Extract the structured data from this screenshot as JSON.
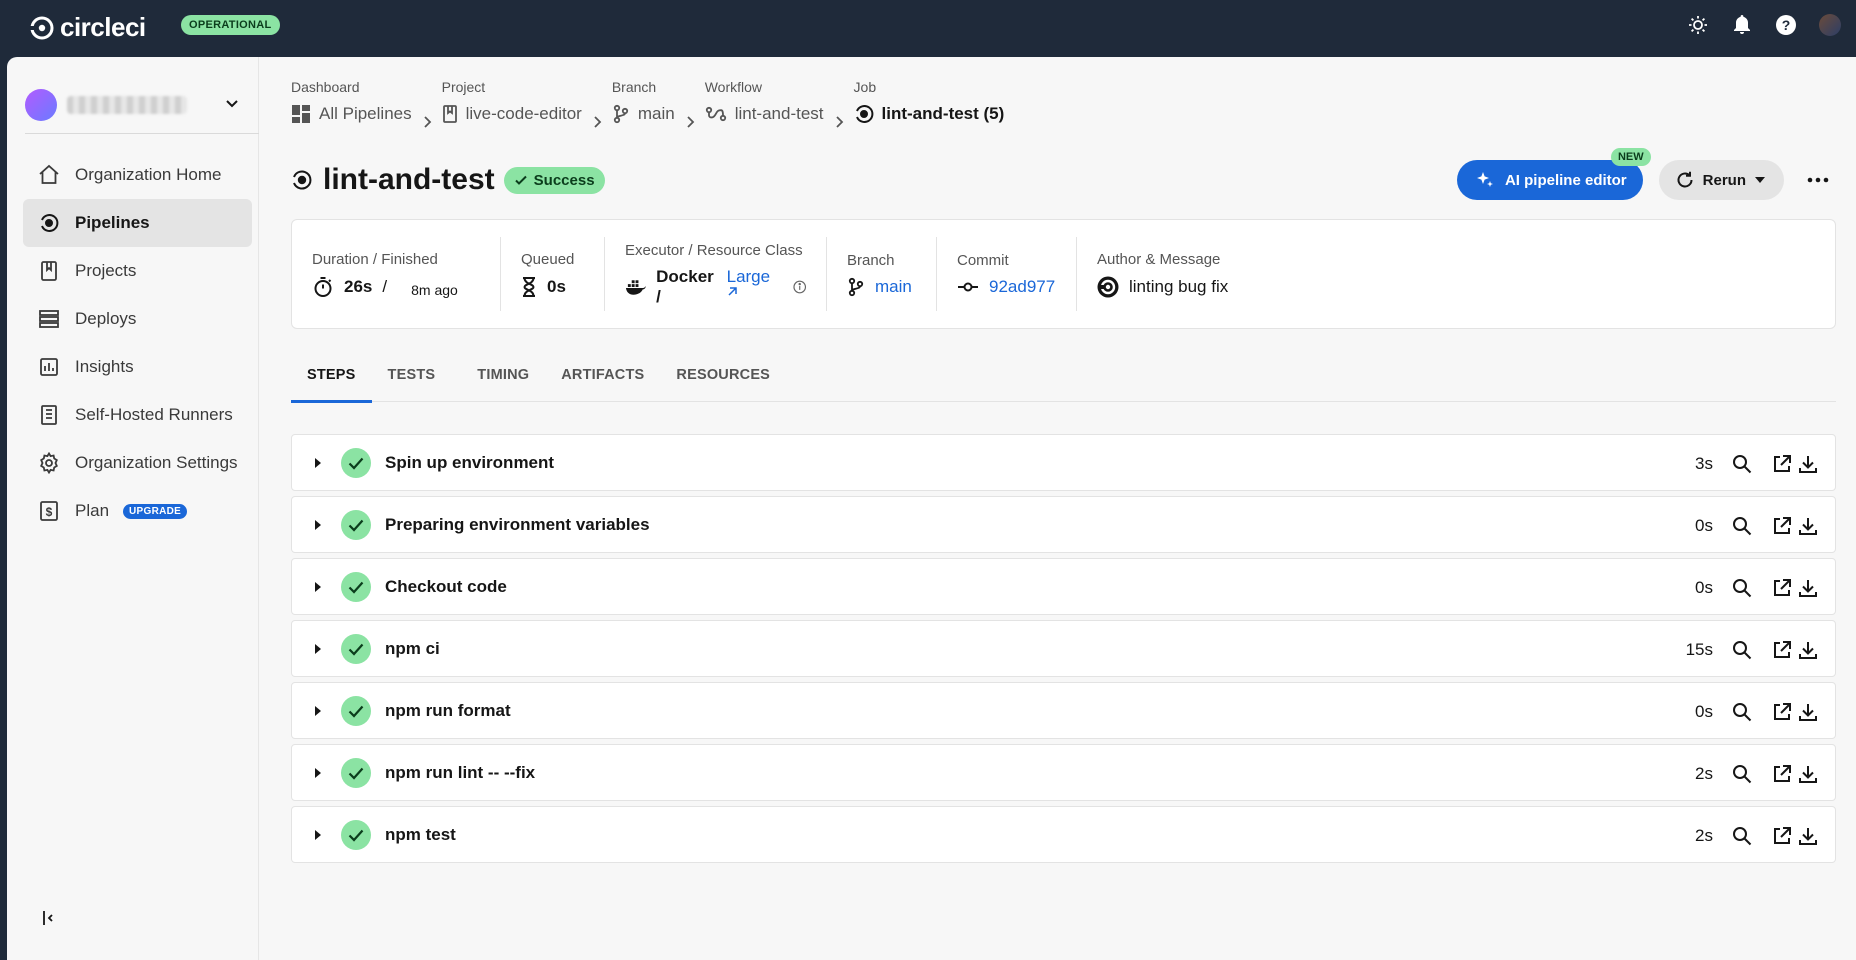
{
  "topbar": {
    "logo_text": "circleci",
    "status": "OPERATIONAL",
    "icons": [
      "sun-icon",
      "bell-icon",
      "help-icon",
      "user-avatar"
    ]
  },
  "sidebar": {
    "items": [
      {
        "label": "Organization Home",
        "icon": "home-icon"
      },
      {
        "label": "Pipelines",
        "icon": "pipelines-icon",
        "active": true
      },
      {
        "label": "Projects",
        "icon": "bookmark-icon"
      },
      {
        "label": "Deploys",
        "icon": "deploys-icon"
      },
      {
        "label": "Insights",
        "icon": "chart-icon"
      },
      {
        "label": "Self-Hosted Runners",
        "icon": "runner-icon"
      },
      {
        "label": "Organization Settings",
        "icon": "gear-icon"
      },
      {
        "label": "Plan",
        "icon": "dollar-icon",
        "badge": "UPGRADE"
      }
    ]
  },
  "breadcrumbs": [
    {
      "label": "Dashboard",
      "value": "All Pipelines"
    },
    {
      "label": "Project",
      "value": "live-code-editor"
    },
    {
      "label": "Branch",
      "value": "main"
    },
    {
      "label": "Workflow",
      "value": "lint-and-test"
    },
    {
      "label": "Job",
      "value": "lint-and-test (5)"
    }
  ],
  "job": {
    "title": "lint-and-test",
    "status": "Success",
    "ai_button": "AI pipeline editor",
    "new_badge": "NEW",
    "rerun_button": "Rerun"
  },
  "meta": {
    "duration_label": "Duration / Finished",
    "duration": "26s",
    "slash": "/",
    "finished": "8m ago",
    "queued_label": "Queued",
    "queued": "0s",
    "executor_label": "Executor / Resource Class",
    "executor": "Docker /",
    "resource_class": "Large",
    "branch_label": "Branch",
    "branch": "main",
    "commit_label": "Commit",
    "commit": "92ad977",
    "author_label": "Author & Message",
    "message": "linting bug fix"
  },
  "tabs": [
    "STEPS",
    "TESTS",
    "TIMING",
    "ARTIFACTS",
    "RESOURCES"
  ],
  "steps": [
    {
      "name": "Spin up environment",
      "duration": "3s"
    },
    {
      "name": "Preparing environment variables",
      "duration": "0s"
    },
    {
      "name": "Checkout code",
      "duration": "0s"
    },
    {
      "name": "npm ci",
      "duration": "15s"
    },
    {
      "name": "npm run format",
      "duration": "0s"
    },
    {
      "name": "npm run lint -- --fix",
      "duration": "2s"
    },
    {
      "name": "npm test",
      "duration": "2s"
    }
  ],
  "colors": {
    "accent": "#1a67d8",
    "success": "#8be3a3",
    "topbar": "#1f2a3a"
  }
}
